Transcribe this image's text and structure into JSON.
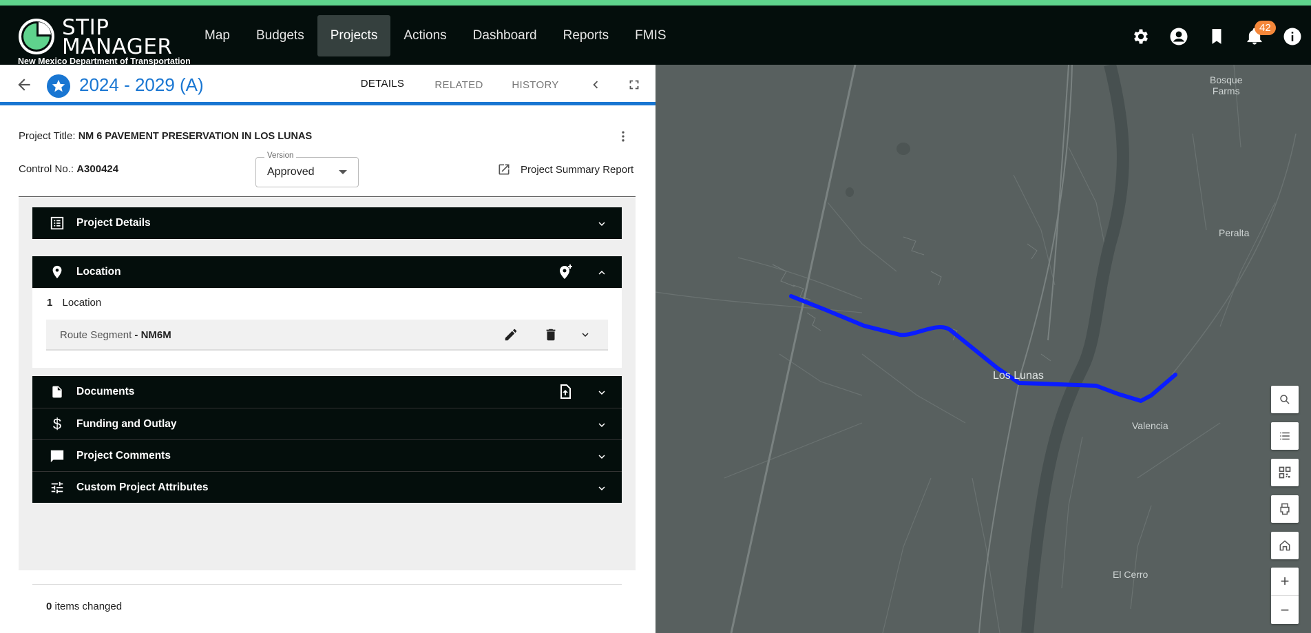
{
  "app": {
    "logo_title": "STIP\nMANAGER",
    "logo_subtitle": "New Mexico Department of Transportation"
  },
  "nav": {
    "items": [
      {
        "label": "Map"
      },
      {
        "label": "Budgets"
      },
      {
        "label": "Projects",
        "active": true
      },
      {
        "label": "Actions"
      },
      {
        "label": "Dashboard"
      },
      {
        "label": "Reports"
      },
      {
        "label": "FMIS"
      }
    ],
    "icons": [
      "gear-icon",
      "account-icon",
      "bookmark-icon",
      "bell-icon",
      "info-icon"
    ],
    "notification_count": "42"
  },
  "header": {
    "title": "2024 - 2029 (A)",
    "tabs": [
      {
        "label": "DETAILS",
        "active": true
      },
      {
        "label": "RELATED"
      },
      {
        "label": "HISTORY"
      }
    ]
  },
  "project": {
    "title_label": "Project Title:",
    "title_value": "NM 6 PAVEMENT PRESERVATION IN LOS LUNAS",
    "control_label": "Control No.:",
    "control_value": "A300424",
    "version_label": "Version",
    "version_value": "Approved",
    "summary_report": "Project Summary Report"
  },
  "sections": {
    "project_details": "Project Details",
    "location": "Location",
    "documents": "Documents",
    "funding": "Funding and Outlay",
    "comments": "Project Comments",
    "custom": "Custom Project Attributes"
  },
  "location": {
    "count": "1",
    "count_label": "Location",
    "segment_type": "Route Segment",
    "segment_value": " - NM6M"
  },
  "footer": {
    "changed_count": "0",
    "changed_label": " items changed"
  },
  "map": {
    "places": [
      "Bosque\nFarms",
      "Peralta",
      "Los Lunas",
      "Valencia",
      "El Cerro"
    ],
    "route_color": "#0a1cff",
    "zoom_in": "+",
    "zoom_out": "−"
  },
  "colors": {
    "accent": "#1976d2",
    "nav_bg": "#040e0c",
    "stripe": "#5fd38d",
    "badge": "#f4873a"
  }
}
